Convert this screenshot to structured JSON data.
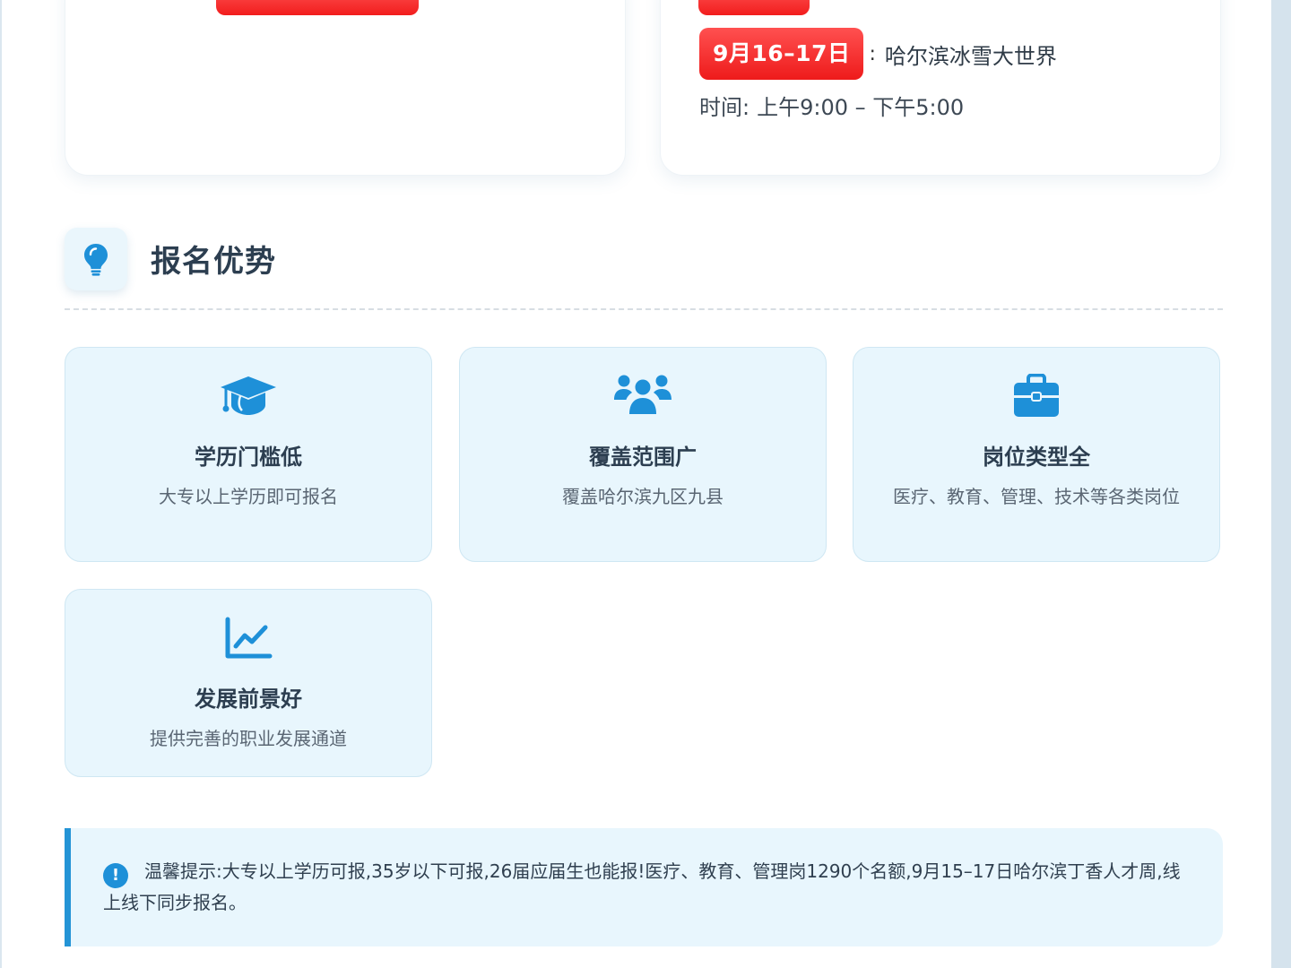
{
  "event": {
    "date_badge": "9月16–17日",
    "separator": ":",
    "venue": "哈尔滨冰雪大世界",
    "time_label": "时间:",
    "time_value": "上午9:00 – 下午5:00"
  },
  "section": {
    "title": "报名优势",
    "icon": "lightbulb-icon"
  },
  "advantages": [
    {
      "icon": "graduation-cap-icon",
      "title": "学历门槛低",
      "desc": "大专以上学历即可报名"
    },
    {
      "icon": "users-group-icon",
      "title": "覆盖范围广",
      "desc": "覆盖哈尔滨九区九县"
    },
    {
      "icon": "briefcase-icon",
      "title": "岗位类型全",
      "desc": "医疗、教育、管理、技术等各类岗位"
    },
    {
      "icon": "chart-line-icon",
      "title": "发展前景好",
      "desc": "提供完善的职业发展通道"
    }
  ],
  "tip": {
    "icon": "exclamation-circle-icon",
    "icon_glyph": "!",
    "text": "温馨提示:大专以上学历可报,35岁以下可报,26届应届生也能报!医疗、教育、管理岗1290个名额,9月15–17日哈尔滨丁香人才周,线上线下同步报名。"
  },
  "colors": {
    "accent": "#2494d6",
    "badge_red": "#f21d1d",
    "card_bg": "#e8f6fd"
  }
}
